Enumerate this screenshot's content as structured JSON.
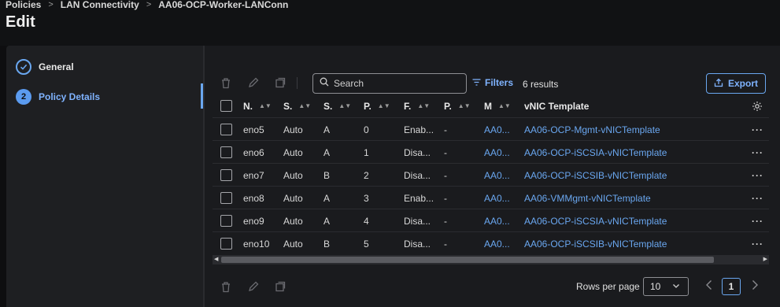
{
  "breadcrumb": {
    "items": [
      "Policies",
      "LAN Connectivity",
      "AA06-OCP-Worker-LANConn"
    ]
  },
  "page": {
    "title": "Edit"
  },
  "wizard": {
    "steps": [
      {
        "number": "1",
        "label": "General",
        "state": "done"
      },
      {
        "number": "2",
        "label": "Policy Details",
        "state": "active"
      }
    ]
  },
  "toolbar": {
    "search_placeholder": "Search",
    "filters_label": "Filters",
    "results_text": "6 results",
    "export_label": "Export"
  },
  "table": {
    "columns": [
      "N.",
      "S.",
      "S.",
      "P.",
      "F.",
      "P.",
      "M",
      "vNIC Template"
    ],
    "rows": [
      [
        "eno5",
        "Auto",
        "A",
        "0",
        "Enab...",
        "-",
        "AA0...",
        "AA06-OCP-Mgmt-vNICTemplate"
      ],
      [
        "eno6",
        "Auto",
        "A",
        "1",
        "Disa...",
        "-",
        "AA0...",
        "AA06-OCP-iSCSIA-vNICTemplate"
      ],
      [
        "eno7",
        "Auto",
        "B",
        "2",
        "Disa...",
        "-",
        "AA0...",
        "AA06-OCP-iSCSIB-vNICTemplate"
      ],
      [
        "eno8",
        "Auto",
        "A",
        "3",
        "Enab...",
        "-",
        "AA0...",
        "AA06-VMMgmt-vNICTemplate"
      ],
      [
        "eno9",
        "Auto",
        "A",
        "4",
        "Disa...",
        "-",
        "AA0...",
        "AA06-OCP-iSCSIA-vNICTemplate"
      ],
      [
        "eno10",
        "Auto",
        "B",
        "5",
        "Disa...",
        "-",
        "AA0...",
        "AA06-OCP-iSCSIB-vNICTemplate"
      ]
    ]
  },
  "pagination": {
    "rows_per_page_label": "Rows per page",
    "rows_per_page_value": "10",
    "current_page": "1"
  },
  "colors": {
    "accent": "#6aa7f0",
    "background": "#0e0e10",
    "panel": "#1e1f22"
  }
}
